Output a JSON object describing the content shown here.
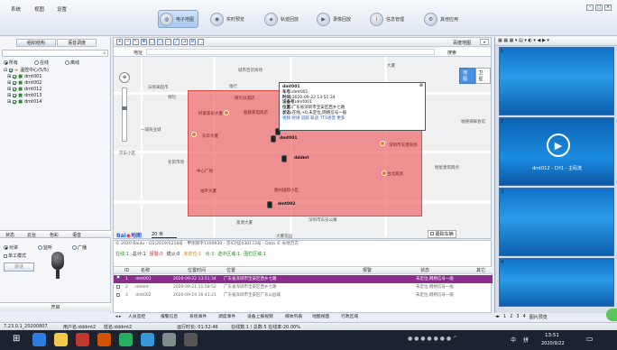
{
  "menu": {
    "system": "系统",
    "view": "视图",
    "settings": "设置"
  },
  "nav": [
    {
      "label": "电子地图",
      "icon": "globe-icon"
    },
    {
      "label": "实时预览",
      "icon": "camera-icon"
    },
    {
      "label": "轨迹回放",
      "icon": "track-icon"
    },
    {
      "label": "录像回放",
      "icon": "video-icon"
    },
    {
      "label": "信息管理",
      "icon": "info-icon"
    },
    {
      "label": "其他应用",
      "icon": "apps-icon"
    }
  ],
  "left": {
    "tab_org": "组织结构",
    "tab_voice": "语音调度",
    "filter_all": "所有",
    "filter_online": "在线",
    "filter_offline": "离线",
    "root": "温控中心(5/5)",
    "devices": [
      "dmt001",
      "dmt002",
      "dmt012",
      "dmt013",
      "dmt014"
    ],
    "tabs": [
      "状态",
      "云台",
      "色彩",
      "语音"
    ],
    "talk_mode": "对讲",
    "monitor_mode": "监听",
    "broadcast_mode": "广播",
    "single_work": "单工模式",
    "talk_button": "讲话",
    "open_button": "开启"
  },
  "map": {
    "address_label": "地址",
    "search_label": "搜索",
    "mode_label": "百度地图",
    "type_map": "地图",
    "type_satellite": "卫星",
    "scale": "20 米",
    "copyright": "© 2020 Baidu - GS(2019)5218号 - 甲测资字1100930 - 京ICP证030173号 - Data © 长地万方",
    "track_label": "跟踪车辆",
    "place_labels": [
      "城市百货商场",
      "大厦",
      "乐购来超市",
      "银行",
      "湖南兴华大厦",
      "保险",
      "德贝派酒店",
      "好家家乐大厦",
      "超群家电商店",
      "一城商业城",
      "东华大厦",
      "京东小区",
      "农贸市场",
      "中心广场",
      "福禧海鲜会馆",
      "深圳市东港商场",
      "明星建筑网点",
      "台北家具",
      "福平大厦",
      "德州国际小区",
      "深圳市东乐公寓",
      "富源大厦",
      "大厦花园"
    ],
    "vehicles": [
      "dmt001",
      "dmt002",
      "dddmt",
      "dmt002"
    ],
    "popup": {
      "title": "dmt001",
      "plate_label": "车号:",
      "plate": "dmt001",
      "time_label": "时间:",
      "time": "2020-09-22 13:51:34",
      "device_label": "设备号:",
      "device": "dmt001",
      "pos_label": "位置:",
      "pos": "广东省深圳市宝安区西乡七路",
      "status_label": "状态:",
      "status": "在线,+0,未定位,网络信号一般",
      "links": "视频 对讲 追踪 轨迹 TTS语音 更多"
    }
  },
  "stats": {
    "online": "在线:1",
    "total": "总计:1",
    "alarm": "报警:0",
    "parked": "熄火:0",
    "unlocated": "未定位:1",
    "point": "点:3",
    "selected": "选中区域:1",
    "zone": "围栏区域:1"
  },
  "table": {
    "headers": [
      "ID",
      "名称",
      "位置时间",
      "位置",
      "报警",
      "状态",
      "其它"
    ],
    "rows": [
      {
        "id": "1",
        "name": "dmt001",
        "time": "2020-09-22 13:51:34",
        "pos": "广东省深圳市宝安区西乡七路",
        "alarm": "",
        "status": "未定位,网络信号一般"
      },
      {
        "id": "2",
        "name": "dddmt",
        "time": "2020-09-21 11:58:52",
        "pos": "广东省深圳市宝安区西乡七路",
        "alarm": "",
        "status": "未定位,网络信号一般"
      },
      {
        "id": "3",
        "name": "dmt002",
        "time": "2020-09-19 16:41:21",
        "pos": "广东省深圳市宝安区广东公园城",
        "alarm": "",
        "status": "未定位,网络信号一般"
      }
    ]
  },
  "bottom_tabs": [
    "人员监控",
    "报警信息",
    "系统事件",
    "调度事件",
    "设备上报视频",
    "媒体列表",
    "地图视图",
    "行政区域"
  ],
  "right_tabs": [
    "1",
    "2",
    "3",
    "4",
    "图片预览"
  ],
  "videos": [
    {
      "num": "1",
      "caption": ""
    },
    {
      "num": "2",
      "caption": "dmt012 - CH1 - 主码流"
    },
    {
      "num": "3",
      "caption": ""
    },
    {
      "num": "4",
      "caption": ""
    }
  ],
  "statusbar": {
    "version": "7.23.0.1_20200807",
    "user": "用户名:dddmt2",
    "name": "姓名:dddmt2",
    "runtime": "运行时长: 01:52:46",
    "online_info": "在线数:1 / 总数:5 在线率:20.00%"
  },
  "taskbar": {
    "time": "13:51",
    "date": "2020/9/22",
    "lang": "中",
    "ime": "拼"
  },
  "colors": {
    "accent": "#8b2d8f",
    "zone": "#ef6b6b",
    "video": "#1a84d8"
  }
}
